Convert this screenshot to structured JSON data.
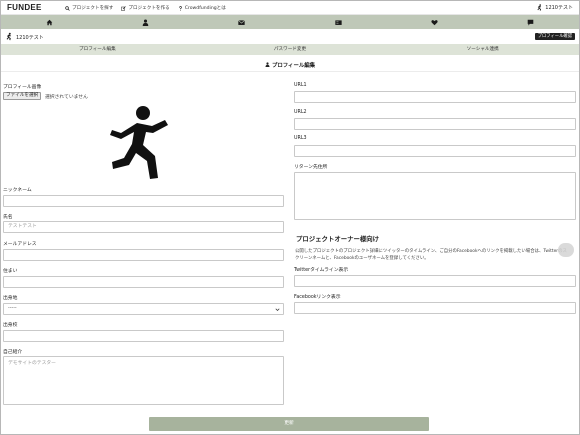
{
  "header": {
    "logo": "FUNDEE",
    "links": [
      {
        "label": "プロジェクトを探す",
        "icon": "search-icon"
      },
      {
        "label": "プロジェクトを作る",
        "icon": "edit-icon"
      },
      {
        "label": "Crowdfundingとは",
        "icon": "question-icon"
      }
    ],
    "username": "1210テスト"
  },
  "icon_nav": [
    "home-icon",
    "user-icon",
    "mail-icon",
    "id-card-icon",
    "heart-icon",
    "chat-icon"
  ],
  "user_strip": {
    "name": "1210テスト",
    "confirm_label": "プロフィール確認"
  },
  "tabs": [
    "プロフィール編集",
    "パスワード変更",
    "ソーシャル連携"
  ],
  "section_title": "プロフィール編集",
  "left": {
    "profile_image_label": "プロフィール画像",
    "file_button": "ファイルを選択",
    "file_status": "選択されていません",
    "nickname_label": "ニックネーム",
    "nickname_value": "",
    "name_label": "氏名",
    "name_placeholder": "テストテスト",
    "email_label": "メールアドレス",
    "email_value": "",
    "address_label": "住まい",
    "address_value": "",
    "birthplace_label": "出身地",
    "birthplace_selected": "-----",
    "school_label": "出身校",
    "school_value": "",
    "intro_label": "自己紹介",
    "intro_placeholder": "デモサイトのテスター"
  },
  "right": {
    "url1_label": "URL1",
    "url2_label": "URL2",
    "url3_label": "URL3",
    "return_label": "リターン先住所",
    "owner_title": "プロジェクトオーナー様向け",
    "owner_desc": "公開したプロジェクトのプロジェクト詳細にツイッターのタイムライン、ご自分のFacebookへのリンクを掲載したい場合は、Twitterのスクリーンネームと、Facebookのユーザネームを登録してください。",
    "twitter_label": "Twitterタイムライン表示",
    "facebook_label": "Facebookリンク表示"
  },
  "update_button": "更新",
  "colors": {
    "nav_green": "#bfc8b8",
    "tab_green": "#dde3d7",
    "button_green": "#a7b39d"
  }
}
